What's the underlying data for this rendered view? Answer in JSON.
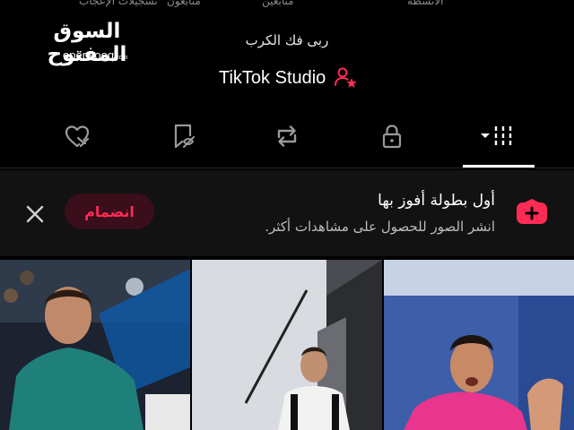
{
  "top_cut_labels": [
    "الأنشطة",
    "متابعين",
    "متابَعون",
    "تسجيلات الإعجاب"
  ],
  "watermark": {
    "arabic": "السوق المفتوح",
    "latin": "opensooq",
    "tld": ".com"
  },
  "profile": {
    "bio": "ربى فك الكرب",
    "studio_label": "TikTok Studio",
    "studio_icon": "user-star-icon"
  },
  "tabs": [
    {
      "name": "videos",
      "icon": "grid-dropdown-icon",
      "active": true
    },
    {
      "name": "private",
      "icon": "lock-icon",
      "active": false
    },
    {
      "name": "reposts",
      "icon": "repost-icon",
      "active": false
    },
    {
      "name": "favorites",
      "icon": "bookmark-hidden-icon",
      "active": false
    },
    {
      "name": "liked",
      "icon": "heart-hidden-icon",
      "active": false
    }
  ],
  "banner": {
    "title": "أول بطولة أفوز بها",
    "subtitle": "انشر الصور للحصول على مشاهدات أكثر.",
    "join_label": "انضمام",
    "icon": "plus-badge-icon",
    "close_icon": "close-icon"
  },
  "colors": {
    "accent": "#fe2c55",
    "background": "#000000",
    "banner_bg": "#121212",
    "join_bg": "#3a0e1a"
  },
  "grid": {
    "items": [
      {
        "name": "video-thumbnail-1"
      },
      {
        "name": "video-thumbnail-2"
      },
      {
        "name": "video-thumbnail-3"
      }
    ]
  }
}
